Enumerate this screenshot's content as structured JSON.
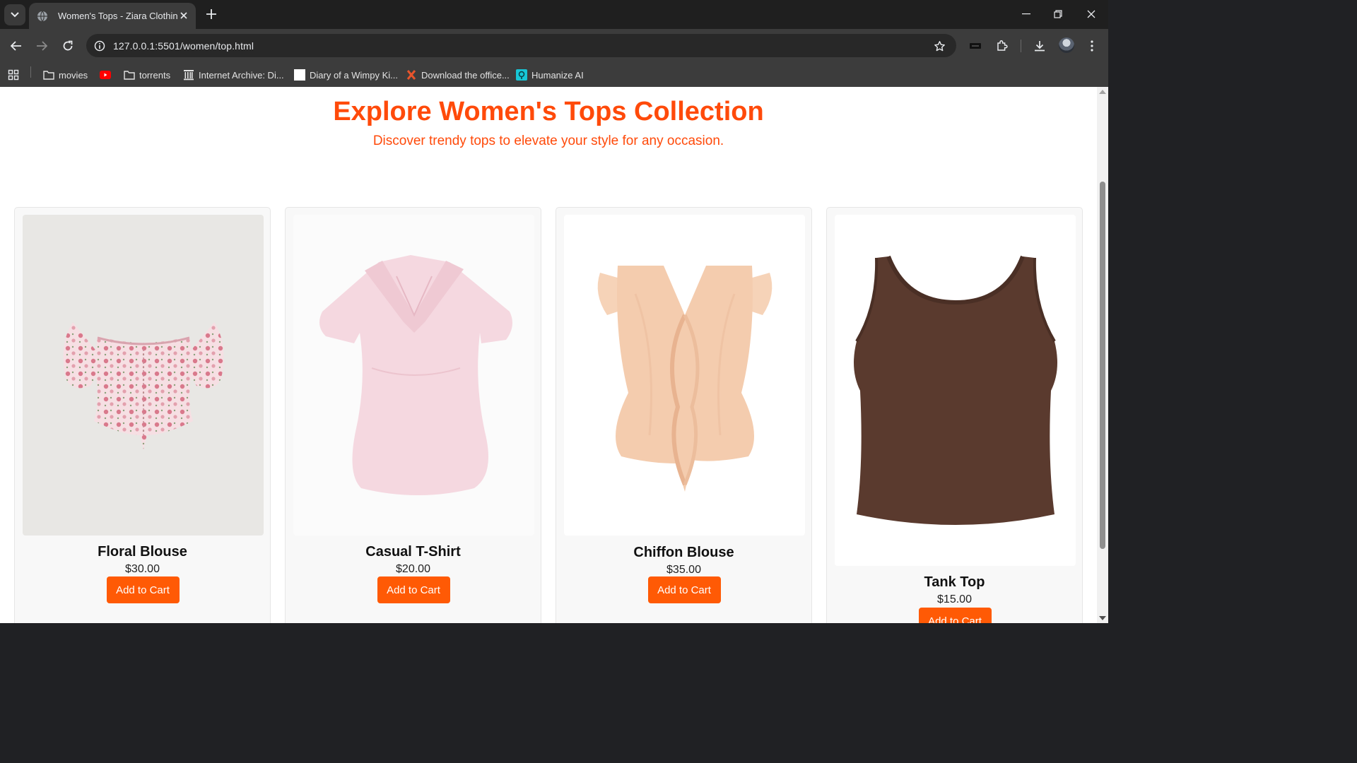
{
  "browser": {
    "tab_title": "Women's Tops - Ziara Clothing",
    "url": "127.0.0.1:5501/women/top.html",
    "bookmarks": [
      {
        "label": "movies",
        "icon": "folder-icon"
      },
      {
        "label": "",
        "icon": "youtube-icon"
      },
      {
        "label": "torrents",
        "icon": "folder-icon"
      },
      {
        "label": "Internet Archive: Di...",
        "icon": "archive-icon"
      },
      {
        "label": "Diary of a Wimpy Ki...",
        "icon": "page-icon"
      },
      {
        "label": "Download the office...",
        "icon": "x-icon"
      },
      {
        "label": "Humanize AI",
        "icon": "humanize-icon"
      }
    ]
  },
  "page": {
    "title": "Explore Women's Tops Collection",
    "subtitle": "Discover trendy tops to elevate your style for any occasion."
  },
  "products": [
    {
      "name": "Floral Blouse",
      "price": "$30.00",
      "button": "Add to Cart",
      "image": "floral-blouse"
    },
    {
      "name": "Casual T-Shirt",
      "price": "$20.00",
      "button": "Add to Cart",
      "image": "pink-collared-tshirt"
    },
    {
      "name": "Chiffon Blouse",
      "price": "$35.00",
      "button": "Add to Cart",
      "image": "peach-chiffon-blouse"
    },
    {
      "name": "Tank Top",
      "price": "$15.00",
      "button": "Add to Cart",
      "image": "brown-tank-top"
    }
  ],
  "colors": {
    "accent": "#ff4a0a",
    "button": "#ff5a05"
  }
}
